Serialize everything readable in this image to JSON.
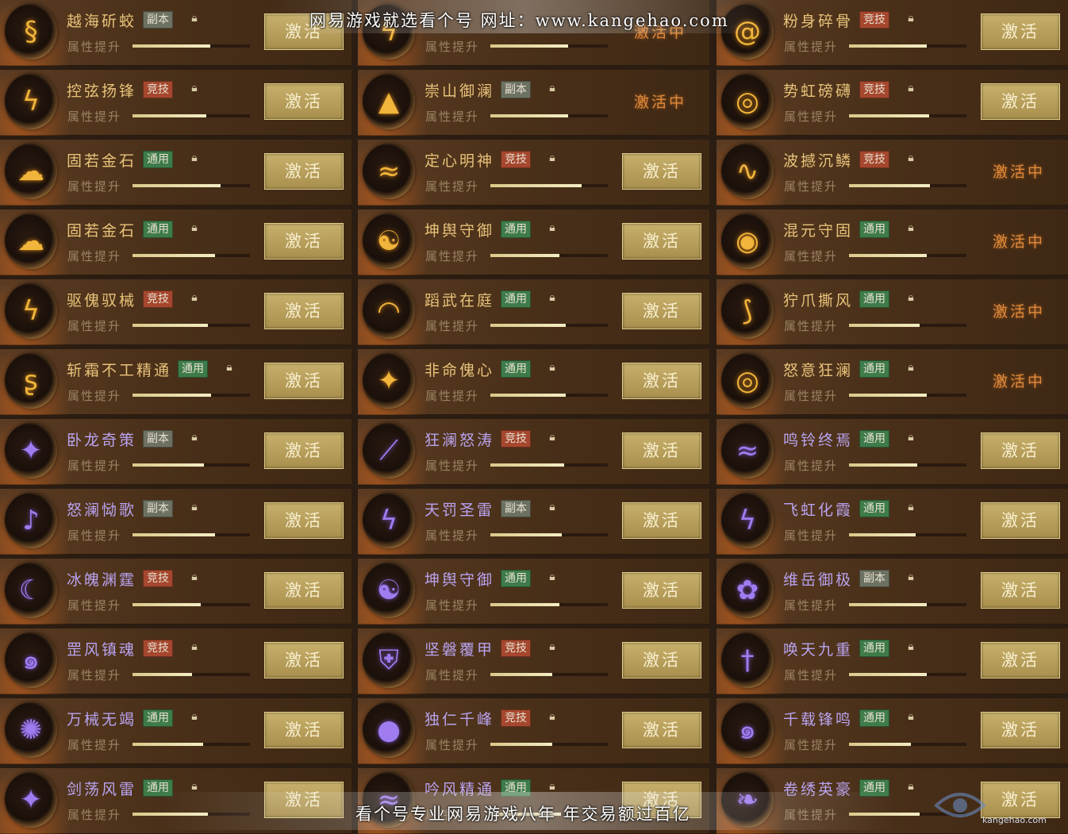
{
  "watermark": {
    "top": "网易游戏就选看个号 网址：www.kangehao.com",
    "bottom": "看个号专业网易游戏八年 年交易额过百亿",
    "logo_text": "kangehao.com"
  },
  "labels": {
    "sub": "属性提升",
    "activate": "激活",
    "active": "激活中"
  },
  "colors": {
    "button": "#b59c5a",
    "active_text": "#e08a3a",
    "tag_fuben": "#6d7162",
    "tag_jingji": "#a5472e",
    "tag_tongyong": "#3e7b4a"
  },
  "rows": [
    [
      {
        "name": "越海斫蛟",
        "tag": "副本",
        "tag_type": "fuben",
        "progress": 0.66,
        "state": "activate",
        "emblem": "gold",
        "icon": "dragon-icon"
      },
      {
        "name": "",
        "tag": "",
        "tag_type": "",
        "progress": 0.66,
        "state": "active",
        "emblem": "gold",
        "icon": "flame-icon"
      },
      {
        "name": "粉身碎骨",
        "tag": "竞技",
        "tag_type": "jingji",
        "progress": 0.66,
        "state": "activate",
        "emblem": "gold",
        "icon": "swirl-icon"
      }
    ],
    [
      {
        "name": "控弦扬锋",
        "tag": "竞技",
        "tag_type": "jingji",
        "progress": 0.63,
        "state": "activate",
        "emblem": "gold",
        "icon": "flame-icon"
      },
      {
        "name": "崇山御澜",
        "tag": "副本",
        "tag_type": "fuben",
        "progress": 0.66,
        "state": "active",
        "emblem": "gold",
        "icon": "mountain-icon"
      },
      {
        "name": "势虹磅礴",
        "tag": "竞技",
        "tag_type": "jingji",
        "progress": 0.68,
        "state": "activate",
        "emblem": "gold",
        "icon": "vortex-icon"
      }
    ],
    [
      {
        "name": "固若金石",
        "tag": "通用",
        "tag_type": "tongyong",
        "progress": 0.75,
        "state": "activate",
        "emblem": "gold",
        "icon": "cloud-icon"
      },
      {
        "name": "定心明神",
        "tag": "竞技",
        "tag_type": "jingji",
        "progress": 0.78,
        "state": "activate",
        "emblem": "gold",
        "icon": "wave-icon"
      },
      {
        "name": "波撼沉鳞",
        "tag": "竞技",
        "tag_type": "jingji",
        "progress": 0.69,
        "state": "active",
        "emblem": "gold",
        "icon": "fish-icon"
      }
    ],
    [
      {
        "name": "固若金石",
        "tag": "通用",
        "tag_type": "tongyong",
        "progress": 0.7,
        "state": "activate",
        "emblem": "gold",
        "icon": "cloud-icon"
      },
      {
        "name": "坤舆守御",
        "tag": "通用",
        "tag_type": "tongyong",
        "progress": 0.59,
        "state": "activate",
        "emblem": "gold",
        "icon": "yinyang-icon"
      },
      {
        "name": "混元守固",
        "tag": "通用",
        "tag_type": "tongyong",
        "progress": 0.66,
        "state": "active",
        "emblem": "gold",
        "icon": "ring-icon"
      }
    ],
    [
      {
        "name": "驱傀驭械",
        "tag": "竞技",
        "tag_type": "jingji",
        "progress": 0.64,
        "state": "activate",
        "emblem": "gold",
        "icon": "flame-icon"
      },
      {
        "name": "蹈武在庭",
        "tag": "通用",
        "tag_type": "tongyong",
        "progress": 0.64,
        "state": "activate",
        "emblem": "gold",
        "icon": "arc-icon"
      },
      {
        "name": "狞爪撕风",
        "tag": "通用",
        "tag_type": "tongyong",
        "progress": 0.6,
        "state": "active",
        "emblem": "gold",
        "icon": "claw-icon"
      }
    ],
    [
      {
        "name": "斩霜不工精通",
        "tag": "通用",
        "tag_type": "tongyong",
        "progress": 0.67,
        "state": "activate",
        "emblem": "gold",
        "icon": "snake-icon"
      },
      {
        "name": "非命傀心",
        "tag": "通用",
        "tag_type": "tongyong",
        "progress": 0.64,
        "state": "activate",
        "emblem": "gold",
        "icon": "feather-icon"
      },
      {
        "name": "怒意狂澜",
        "tag": "通用",
        "tag_type": "tongyong",
        "progress": 0.66,
        "state": "active",
        "emblem": "gold",
        "icon": "vortex-icon"
      }
    ],
    [
      {
        "name": "卧龙奇策",
        "tag": "副本",
        "tag_type": "fuben",
        "progress": 0.61,
        "state": "activate",
        "emblem": "purple",
        "icon": "feather-icon"
      },
      {
        "name": "狂澜怒涛",
        "tag": "竞技",
        "tag_type": "jingji",
        "progress": 0.63,
        "state": "activate",
        "emblem": "purple",
        "icon": "blade-icon"
      },
      {
        "name": "鸣铃终焉",
        "tag": "通用",
        "tag_type": "tongyong",
        "progress": 0.58,
        "state": "activate",
        "emblem": "purple",
        "icon": "wave-icon"
      }
    ],
    [
      {
        "name": "怒澜恸歌",
        "tag": "副本",
        "tag_type": "fuben",
        "progress": 0.7,
        "state": "activate",
        "emblem": "purple",
        "icon": "note-icon"
      },
      {
        "name": "天罚圣雷",
        "tag": "副本",
        "tag_type": "fuben",
        "progress": 0.61,
        "state": "activate",
        "emblem": "purple",
        "icon": "lightning-icon"
      },
      {
        "name": "飞虹化霞",
        "tag": "通用",
        "tag_type": "tongyong",
        "progress": 0.57,
        "state": "activate",
        "emblem": "purple",
        "icon": "flame-icon"
      }
    ],
    [
      {
        "name": "冰魄渊霆",
        "tag": "竞技",
        "tag_type": "jingji",
        "progress": 0.58,
        "state": "activate",
        "emblem": "purple",
        "icon": "moon-icon"
      },
      {
        "name": "坤舆守御",
        "tag": "通用",
        "tag_type": "tongyong",
        "progress": 0.59,
        "state": "activate",
        "emblem": "purple",
        "icon": "yinyang-icon"
      },
      {
        "name": "维岳御极",
        "tag": "副本",
        "tag_type": "fuben",
        "progress": 0.66,
        "state": "activate",
        "emblem": "purple",
        "icon": "bloom-icon"
      }
    ],
    [
      {
        "name": "罡风镇魂",
        "tag": "竞技",
        "tag_type": "jingji",
        "progress": 0.51,
        "state": "activate",
        "emblem": "purple",
        "icon": "spiral-icon"
      },
      {
        "name": "坚磐覆甲",
        "tag": "竞技",
        "tag_type": "jingji",
        "progress": 0.53,
        "state": "activate",
        "emblem": "purple",
        "icon": "shield-icon"
      },
      {
        "name": "唤天九重",
        "tag": "通用",
        "tag_type": "tongyong",
        "progress": 0.66,
        "state": "activate",
        "emblem": "purple",
        "icon": "sword-icon"
      }
    ],
    [
      {
        "name": "万械无竭",
        "tag": "通用",
        "tag_type": "tongyong",
        "progress": 0.6,
        "state": "activate",
        "emblem": "purple",
        "icon": "gear-icon"
      },
      {
        "name": "独仁千峰",
        "tag": "竞技",
        "tag_type": "jingji",
        "progress": 0.53,
        "state": "activate",
        "emblem": "purple",
        "icon": "orb-icon"
      },
      {
        "name": "千载锋鸣",
        "tag": "通用",
        "tag_type": "tongyong",
        "progress": 0.53,
        "state": "activate",
        "emblem": "purple",
        "icon": "spiral-icon"
      }
    ],
    [
      {
        "name": "剑荡风雷",
        "tag": "通用",
        "tag_type": "tongyong",
        "progress": 0.64,
        "state": "activate",
        "emblem": "purple",
        "icon": "feather-icon"
      },
      {
        "name": "吟风精通",
        "tag": "通用",
        "tag_type": "tongyong",
        "progress": 0.6,
        "state": "activate",
        "emblem": "purple",
        "icon": "wave-icon"
      },
      {
        "name": "卷绣英豪",
        "tag": "通用",
        "tag_type": "tongyong",
        "progress": 0.6,
        "state": "activate",
        "emblem": "purple",
        "icon": "wing-icon"
      }
    ]
  ]
}
